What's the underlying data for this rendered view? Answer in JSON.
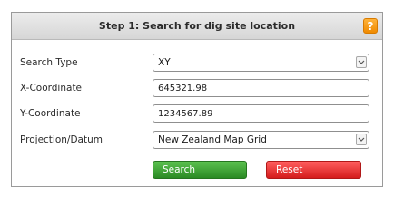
{
  "panel": {
    "title": "Step 1: Search for dig site location",
    "help_label": "?"
  },
  "form": {
    "search_type": {
      "label": "Search Type",
      "value": "XY"
    },
    "x_coordinate": {
      "label": "X-Coordinate",
      "value": "645321.98"
    },
    "y_coordinate": {
      "label": "Y-Coordinate",
      "value": "1234567.89"
    },
    "projection": {
      "label": "Projection/Datum",
      "value": "New Zealand Map Grid"
    }
  },
  "buttons": {
    "search_label": "Search",
    "reset_label": "Reset"
  },
  "colors": {
    "search_button": "#3aa332",
    "reset_button": "#e53030",
    "help_button": "#f59a12"
  }
}
